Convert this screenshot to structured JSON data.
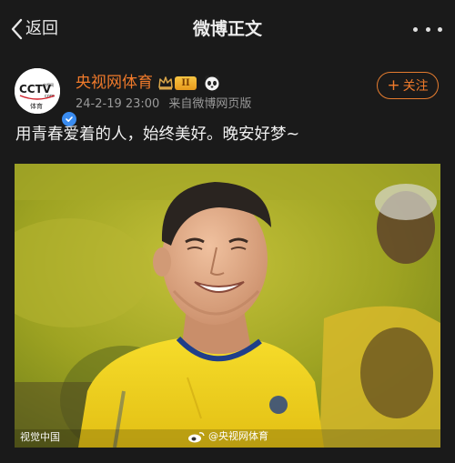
{
  "nav": {
    "back_label": "返回",
    "title": "微博正文"
  },
  "post": {
    "username": "央视网体育",
    "level_badge": "II",
    "time": "24-2-19 23:00",
    "source": "来自微博网页版",
    "follow_label": "关注",
    "text": "用青春爱着的人，始终美好。晚安好梦~",
    "avatar": {
      "logo_text": "CCTV",
      "logo_com": ".com",
      "logo_sub": "体育"
    }
  },
  "photo": {
    "watermark_left": "视觉中国",
    "watermark_center": "@央视网体育"
  },
  "colors": {
    "background": "#1a1a1a",
    "accent": "#f07a2b",
    "verified": "#3a8cf0",
    "jersey": "#f2d41f"
  }
}
